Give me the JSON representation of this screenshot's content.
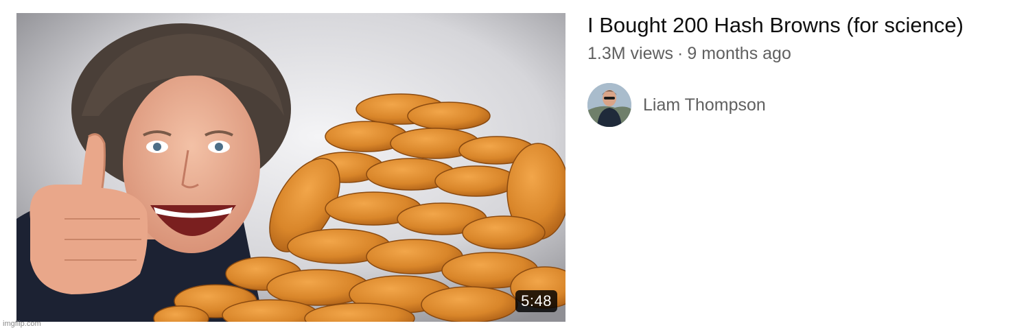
{
  "video": {
    "title": "I Bought 200 Hash Browns (for science)",
    "views": "1.3M views",
    "separator": "·",
    "age": "9 months ago",
    "duration": "5:48",
    "thumbnail": "thumbnail-image"
  },
  "channel": {
    "name": "Liam Thompson",
    "avatar": "channel-avatar"
  },
  "watermark": "imgflip.com"
}
